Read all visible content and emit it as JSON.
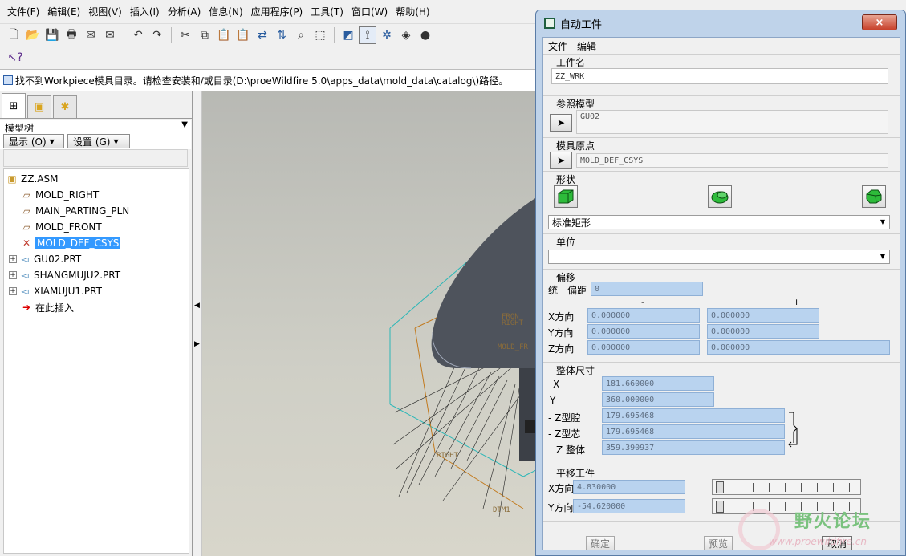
{
  "menubar": {
    "items": [
      "文件(F)",
      "编辑(E)",
      "视图(V)",
      "插入(I)",
      "分析(A)",
      "信息(N)",
      "应用程序(P)",
      "工具(T)",
      "窗口(W)",
      "帮助(H)"
    ]
  },
  "toolbar": {
    "icons": [
      "new-icon",
      "open-icon",
      "save-icon",
      "print-icon",
      "send-icon",
      "mail-icon",
      "undo-icon",
      "redo-icon",
      "cut-icon",
      "copy-icon",
      "paste-icon",
      "paste-special-icon",
      "regenerate-icon",
      "regenerate-manager-icon",
      "find-icon",
      "select-box-icon",
      "datum-display-icon",
      "axis-display-icon",
      "spin-center-icon",
      "render-icon",
      "shade-icon"
    ],
    "context_help_icon": "context-help-icon"
  },
  "message": {
    "text": "找不到Workpiece模具目录。请检查安装和/或目录(D:\\proeWildfire 5.0\\apps_data\\mold_data\\catalog\\)路径。"
  },
  "model_tree": {
    "title": "模型树",
    "show_button": "显示 (O)",
    "settings_button": "设置 (G)",
    "items": [
      {
        "label": "ZZ.ASM",
        "icon": "assembly-icon",
        "expander": ""
      },
      {
        "label": "MOLD_RIGHT",
        "icon": "datum-plane-icon",
        "expander": ""
      },
      {
        "label": "MAIN_PARTING_PLN",
        "icon": "datum-plane-icon",
        "expander": ""
      },
      {
        "label": "MOLD_FRONT",
        "icon": "datum-plane-icon",
        "expander": ""
      },
      {
        "label": "MOLD_DEF_CSYS",
        "icon": "csys-icon",
        "expander": ""
      },
      {
        "label": "GU02.PRT",
        "icon": "part-icon",
        "expander": "+"
      },
      {
        "label": "SHANGMUJU2.PRT",
        "icon": "part-icon",
        "expander": "+"
      },
      {
        "label": "XIAMUJU1.PRT",
        "icon": "part-icon",
        "expander": "+"
      },
      {
        "label": "在此插入",
        "icon": "insert-here-icon",
        "expander": ""
      }
    ]
  },
  "graphics": {
    "labels": [
      "RIGHT",
      "FRON",
      "MOLD_FR",
      "RIGHT",
      "DTM1"
    ]
  },
  "dialog": {
    "title": "自动工件",
    "close": "×",
    "menu": [
      "文件",
      "编辑"
    ],
    "workpiece_name_label": "工件名",
    "workpiece_name": "ZZ_WRK",
    "ref_model_label": "参照模型",
    "ref_model": "GU02",
    "mold_origin_label": "模具原点",
    "mold_origin": "MOLD_DEF_CSYS",
    "shape_label": "形状",
    "shape_icons": [
      "box-shape-icon",
      "cylinder-shape-icon",
      "custom-shape-icon"
    ],
    "shape_select": "标准矩形",
    "units_label": "单位",
    "units_select": "",
    "offset_label": "偏移",
    "uniform_offset_label": "统一偏距",
    "uniform_offset": "0",
    "minus_header": "-",
    "plus_header": "+",
    "x_dir": "X方向",
    "y_dir": "Y方向",
    "z_dir": "Z方向",
    "offsets": {
      "x_minus": "0.000000",
      "x_plus": "0.000000",
      "y_minus": "0.000000",
      "y_plus": "0.000000",
      "z_minus": "0.000000",
      "z_plus": "0.000000"
    },
    "overall_label": "整体尺寸",
    "dim_x_label": "X",
    "dim_y_label": "Y",
    "dim_zcav_label": "- Z型腔",
    "dim_zcore_label": "- Z型芯",
    "dim_ztotal_label": "Z 整体",
    "dim_x": "181.660000",
    "dim_y": "360.000000",
    "dim_zcav": "179.695468",
    "dim_zcore": "179.695468",
    "dim_ztotal": "359.390937",
    "translate_label": "平移工件",
    "tx_label": "X方向",
    "ty_label": "Y方向",
    "tx": "4.830000",
    "ty": "-54.620000",
    "ok": "确定",
    "preview": "预览",
    "cancel": "取消"
  },
  "watermark": {
    "title": "野火论坛",
    "url": "www.proewildfire.cn"
  }
}
